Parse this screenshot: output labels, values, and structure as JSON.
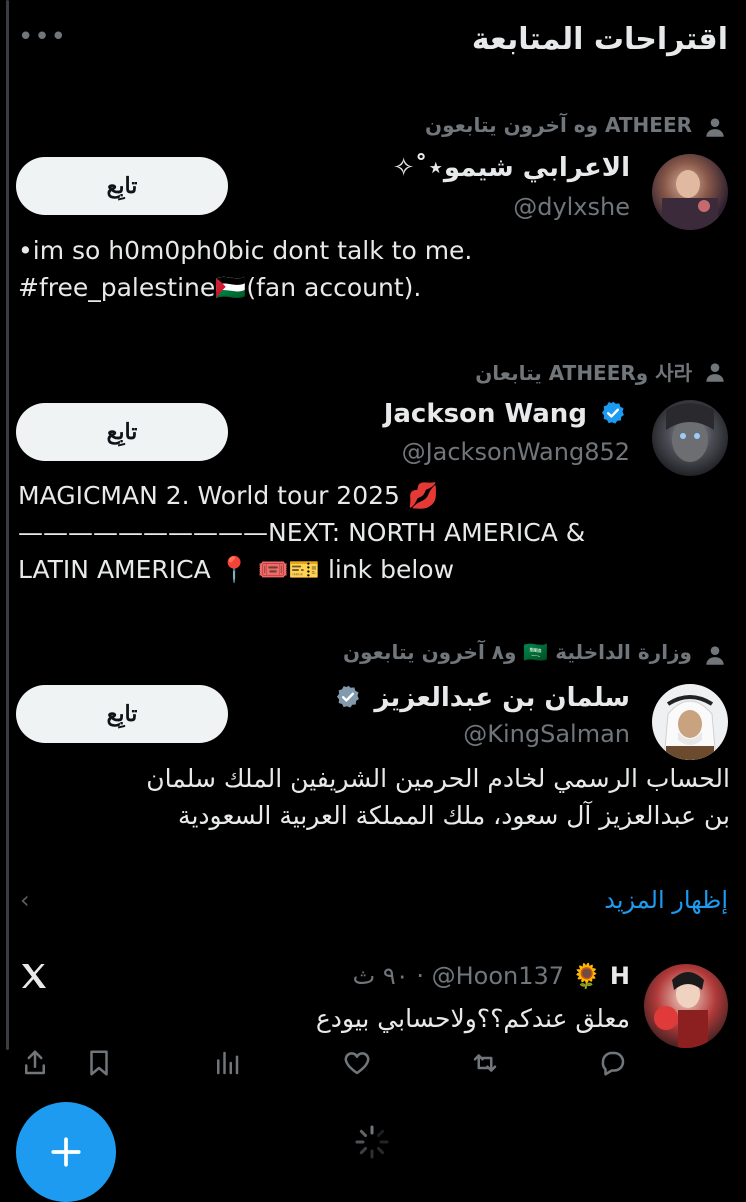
{
  "header": {
    "title": "اقتراحات المتابعة",
    "more_label": "•••"
  },
  "suggestions": [
    {
      "context": "ATHEER وه آخرون يتابعون",
      "name": "الاعرابي شيمو⋆˚✧",
      "handle": "@dylxshe",
      "follow_label": "تابِع",
      "verified": false,
      "bio_lines": [
        "•im so h0m0ph0bic dont talk to me.",
        "#free_palestine🇵🇸(fan account)."
      ]
    },
    {
      "context": "사라 وATHEER يتابعان",
      "name": "Jackson Wang",
      "handle": "@JacksonWang852",
      "follow_label": "تابِع",
      "verified": true,
      "badge_color": "#1d9bf0",
      "bio_lines": [
        "MAGICMAN 2. World tour 2025 💋",
        "——————————NEXT: NORTH AMERICA &",
        "LATIN AMERICA 📍 🎟️🎫 link below"
      ]
    },
    {
      "context": "وزارة الداخلية 🇸🇦 و٨ آخرون يتابعون",
      "name": "سلمان بن عبدالعزيز",
      "handle": "@KingSalman",
      "follow_label": "تابِع",
      "verified": true,
      "badge_color": "#829aab",
      "bio_lines": [
        "الحساب الرسمي لخادم الحرمين الشريفين الملك سلمان",
        "بن عبدالعزيز آل سعود، ملك المملكة العربية السعودية"
      ]
    }
  ],
  "show_more_label": "إظهار المزيد",
  "tweet": {
    "display_name": "🌻 H",
    "handle": "@Hoon137",
    "separator": "·",
    "time": "٩٠ ث",
    "text": "معلق عندكم؟؟ولاحسابي بيودع"
  },
  "icons": {
    "person": "person-icon",
    "verified": "verified-badge-icon",
    "x_logo": "x-logo-icon",
    "share": "share-icon",
    "bookmark": "bookmark-icon",
    "views": "views-icon",
    "like": "heart-icon",
    "retweet": "retweet-icon",
    "reply": "reply-icon",
    "compose": "plus-icon",
    "loading": "loading-spinner-icon"
  },
  "colors": {
    "accent": "#1d9bf0",
    "muted": "#71767b",
    "background": "#000000",
    "follow_button": "#eff3f4"
  }
}
